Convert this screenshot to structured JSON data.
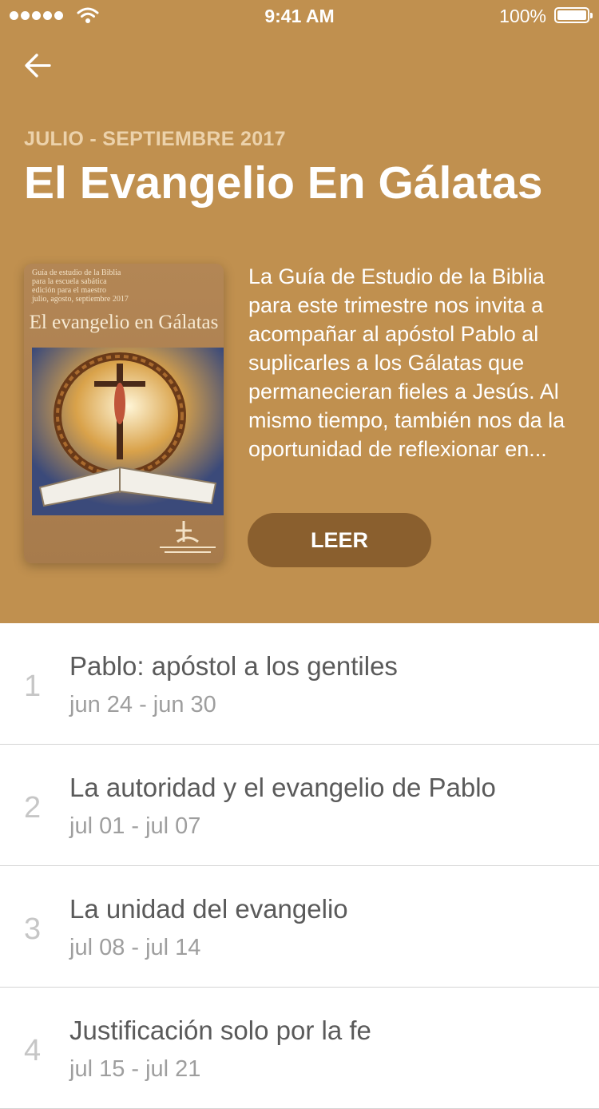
{
  "status": {
    "time": "9:41 AM",
    "battery": "100%"
  },
  "header": {
    "period": "JULIO - SEPTIEMBRE 2017",
    "title": "El Evangelio En Gálatas",
    "description": "La Guía de Estudio de la Biblia para este trimestre nos invita a acompañar al apóstol Pablo al suplicarles a los Gálatas que permanecieran fieles a Jesús. Al mismo tiempo, también nos da la oportunidad de reflexionar en...",
    "read_label": "LEER",
    "background_color": "#c0904f",
    "button_color": "#8a5f2e"
  },
  "cover": {
    "small_lines": [
      "Guía de estudio de la Biblia",
      "para la escuela sabática",
      "edición para el maestro",
      "julio, agosto, septiembre 2017"
    ],
    "title": "El evangelio en Gálatas"
  },
  "lessons": [
    {
      "number": "1",
      "title": "Pablo: apóstol a los gentiles",
      "dates": "jun 24 - jun 30"
    },
    {
      "number": "2",
      "title": "La autoridad y el evangelio de Pablo",
      "dates": "jul 01 - jul 07"
    },
    {
      "number": "3",
      "title": "La unidad del evangelio",
      "dates": "jul 08 - jul 14"
    },
    {
      "number": "4",
      "title": "Justificación solo por la fe",
      "dates": "jul 15 - jul 21"
    }
  ],
  "icons": {
    "back": "arrow-left-icon",
    "signal": "signal-dots-icon",
    "wifi": "wifi-icon",
    "battery": "battery-icon"
  }
}
